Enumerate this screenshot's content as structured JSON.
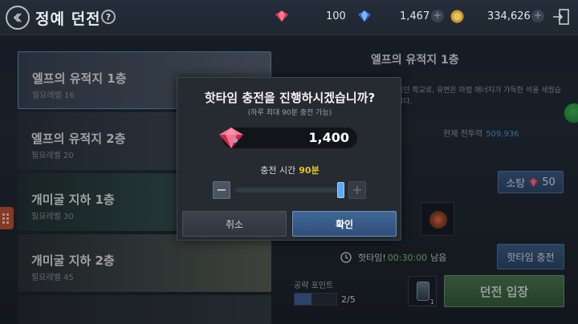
{
  "header": {
    "title": "정예 던전",
    "help": "?",
    "resources": [
      {
        "icon": "ruby-gem-icon",
        "value": "100"
      },
      {
        "icon": "blue-gem-icon",
        "value": "1,467"
      },
      {
        "icon": "gold-coin-icon",
        "value": "334,626"
      }
    ],
    "plus": "+"
  },
  "dungeons": [
    {
      "name": "엘프의 유적지 1층",
      "req": "필요레벨 16",
      "selected": true
    },
    {
      "name": "엘프의 유적지 2층",
      "req": "필요레벨 20",
      "selected": false
    },
    {
      "name": "개미굴 지하 1층",
      "req": "필요레벨 30",
      "selected": false
    },
    {
      "name": "개미굴 지하 2층",
      "req": "필요레벨 45",
      "selected": false
    }
  ],
  "detail": {
    "title": "엘프의 유적지 1층",
    "desc": "지던 학교로, 유면은 마법 에너지가 가득한 석을 세웠습니다.",
    "power_label": "현재 전투력",
    "power_value": "509,936",
    "sweep_label": "소탕",
    "sweep_cost": "50",
    "timer_prefix": "핫타임!",
    "timer_value": "00:30:00",
    "timer_suffix": "남음",
    "hottime_button": "핫타임 충전",
    "points_label": "공략 포인트",
    "points_value": "2/5",
    "points_fraction": 0.4,
    "item_count": "1",
    "enter_button": "던전 입장"
  },
  "modal": {
    "title": "핫타임 충전을 진행하시겠습니까?",
    "subtitle": "(하루 최대 90분 충전 가능)",
    "amount": "1,400",
    "time_label": "충전 시간",
    "time_value": "90분",
    "minus": "−",
    "plus": "+",
    "slider_fraction": 1.0,
    "cancel": "취소",
    "confirm": "확인"
  },
  "colors": {
    "accent_blue": "#4d9fe6",
    "highlight_yellow": "#e5c233",
    "timer_green": "#7bd36b"
  }
}
